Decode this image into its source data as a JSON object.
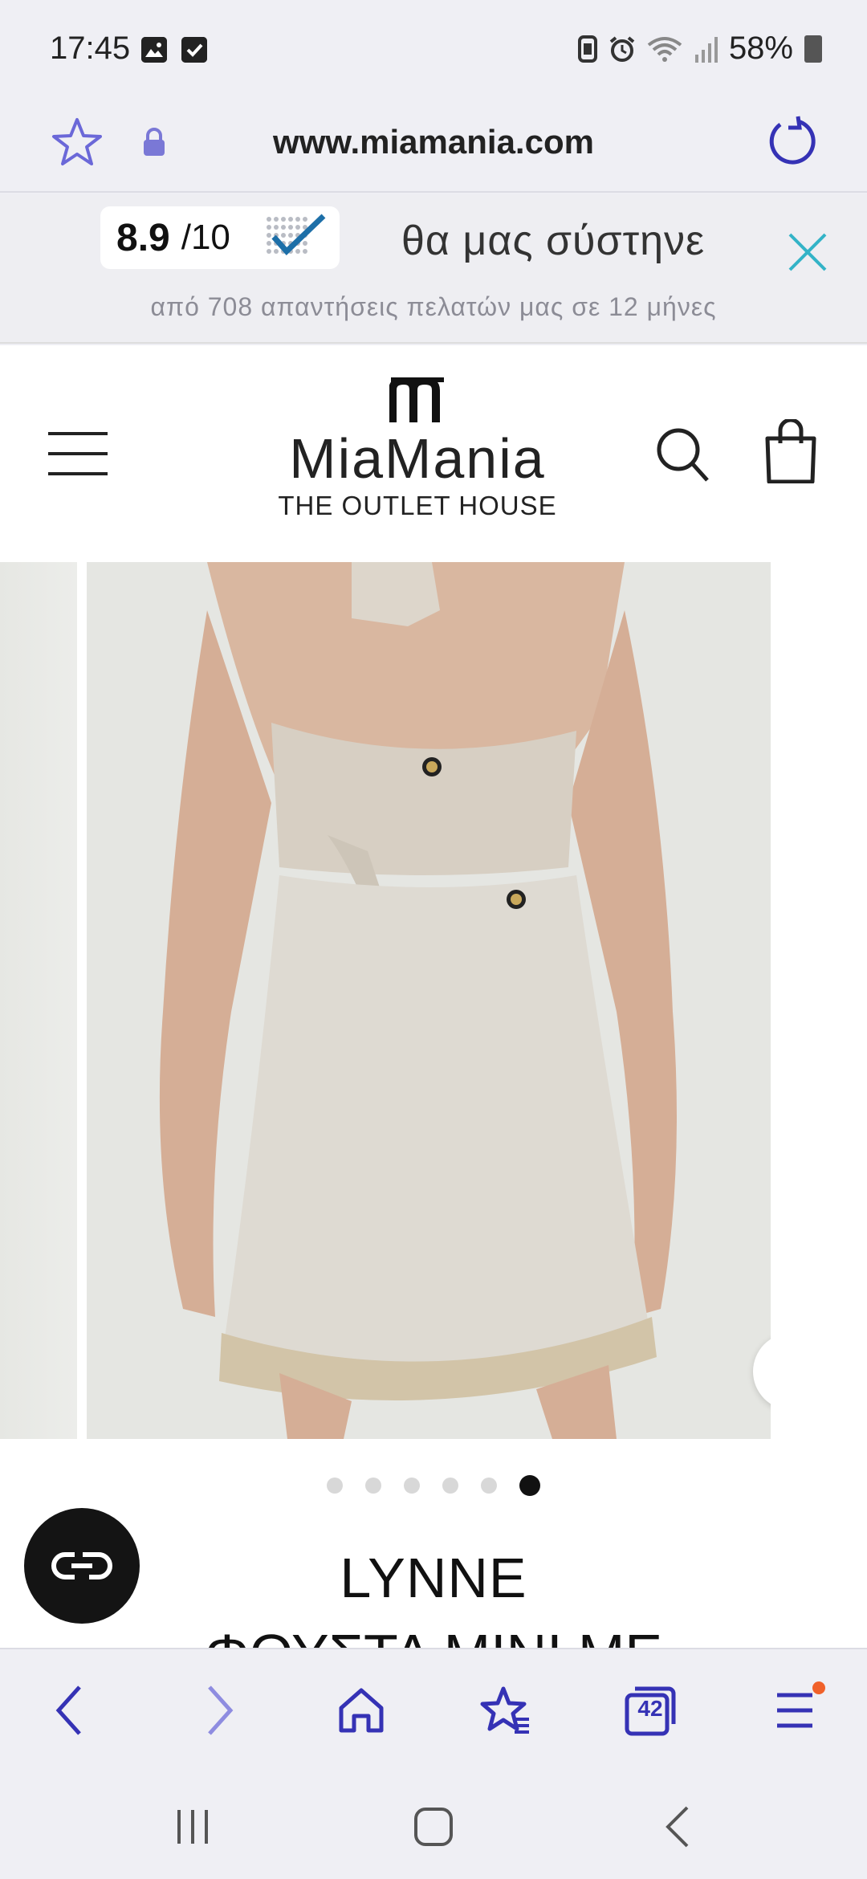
{
  "status_bar": {
    "time": "17:45",
    "battery": "58%",
    "left_icons": [
      "gallery-icon",
      "check-icon"
    ],
    "right_icons": [
      "card-icon",
      "alarm-icon",
      "wifi-icon",
      "signal-icon",
      "battery-icon"
    ]
  },
  "browser": {
    "url": "www.miamania.com",
    "tab_count": "42",
    "accent_color": "#3532b5"
  },
  "review_banner": {
    "score": "8.9",
    "score_of": "/10",
    "text": "θα μας σύστηνε",
    "subtext": "από 708 απαντήσεις πελατών μας σε 12 μήνες",
    "close_color": "#33b3c7"
  },
  "site": {
    "brand_name": "MiaMania",
    "brand_tagline": "THE OUTLET HOUSE"
  },
  "product": {
    "title": "LYNNE",
    "subtitle": "ΦΟΥΣΤΑ MINI ΜΕ",
    "gallery_dots": 6,
    "active_dot": 6
  }
}
